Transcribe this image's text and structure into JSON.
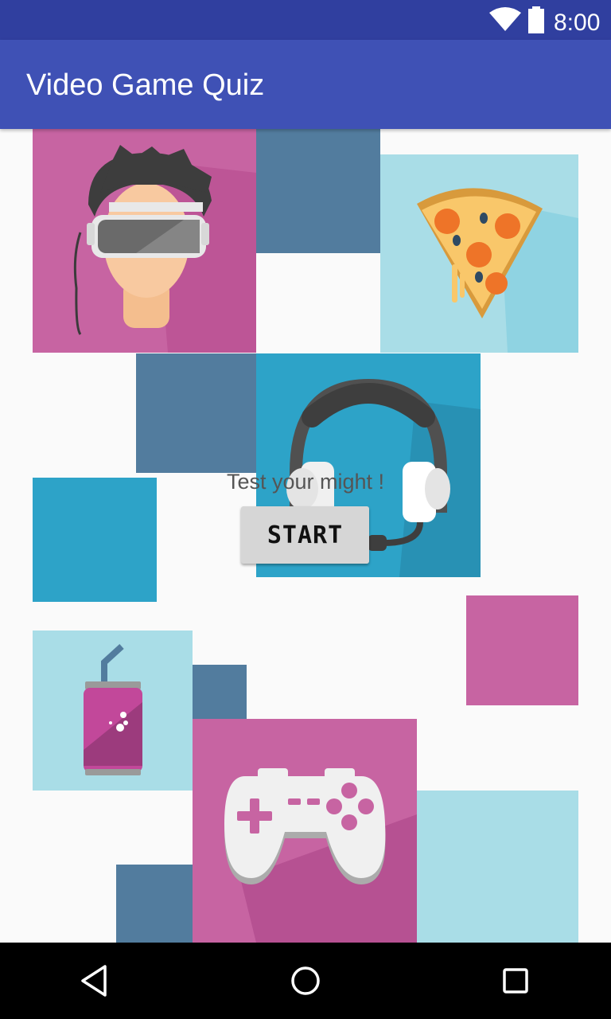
{
  "status_bar": {
    "time": "8:00",
    "icons": [
      "wifi-icon",
      "battery-icon"
    ]
  },
  "app_bar": {
    "title": "Video Game Quiz"
  },
  "main": {
    "tagline": "Test your might !",
    "start_label": "START",
    "illustrations": [
      "vr-headset",
      "pizza-slice",
      "headphones",
      "soda-can",
      "game-controller"
    ]
  },
  "nav_bar": {
    "buttons": [
      "back",
      "home",
      "recents"
    ]
  },
  "colors": {
    "status_bar": "#303f9f",
    "app_bar": "#3f51b5",
    "pink": "#c764a2",
    "light_blue": "#a9dde7",
    "steel_blue": "#527c9e",
    "cyan": "#2da3c8",
    "button": "#d6d6d6"
  }
}
